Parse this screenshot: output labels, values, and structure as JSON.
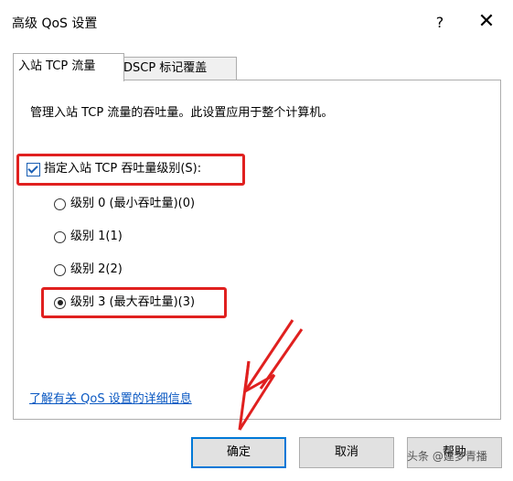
{
  "window": {
    "title": "高级 QoS 设置",
    "help_label": "?",
    "close_label": "✕"
  },
  "tabs": [
    {
      "label": "入站 TCP 流量",
      "active": true
    },
    {
      "label": "DSCP 标记覆盖",
      "active": false
    }
  ],
  "panel": {
    "description": "管理入站 TCP 流量的吞吐量。此设置应用于整个计算机。",
    "checkbox": {
      "label": "指定入站 TCP 吞吐量级别(S):",
      "checked": true
    },
    "radios": [
      {
        "label": "级别 0 (最小吞吐量)(0)",
        "selected": false
      },
      {
        "label": "级别 1(1)",
        "selected": false
      },
      {
        "label": "级别 2(2)",
        "selected": false
      },
      {
        "label": "级别 3 (最大吞吐量)(3)",
        "selected": true
      }
    ],
    "link": "了解有关 QoS 设置的详细信息"
  },
  "buttons": {
    "ok": "确定",
    "cancel": "取消",
    "help": "帮助"
  },
  "watermark": "头条 @建梦青播",
  "colors": {
    "highlight": "#e0201f",
    "primary_border": "#0078d7",
    "link": "#0a58c2"
  }
}
